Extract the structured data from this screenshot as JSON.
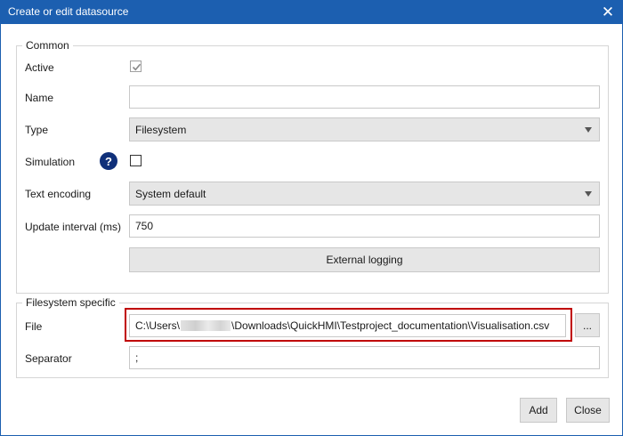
{
  "window": {
    "title": "Create or edit datasource",
    "close_glyph": "✕"
  },
  "common": {
    "legend": "Common",
    "active_label": "Active",
    "active_checked": true,
    "name_label": "Name",
    "name_value": "",
    "type_label": "Type",
    "type_value": "Filesystem",
    "simulation_label": "Simulation",
    "simulation_help": "?",
    "simulation_checked": false,
    "encoding_label": "Text encoding",
    "encoding_value": "System default",
    "interval_label": "Update interval (ms)",
    "interval_value": "750",
    "external_logging_label": "External logging"
  },
  "filesystem": {
    "legend": "Filesystem specific",
    "file_label": "File",
    "file_path_prefix": "C:\\Users\\",
    "file_path_suffix": "\\Downloads\\QuickHMI\\Testproject_documentation\\Visualisation.csv",
    "browse_label": "...",
    "separator_label": "Separator",
    "separator_value": ";"
  },
  "footer": {
    "add_label": "Add",
    "close_label": "Close"
  },
  "colors": {
    "titlebar": "#1c5fb0",
    "highlight": "#c00000",
    "help_icon": "#10307a"
  }
}
